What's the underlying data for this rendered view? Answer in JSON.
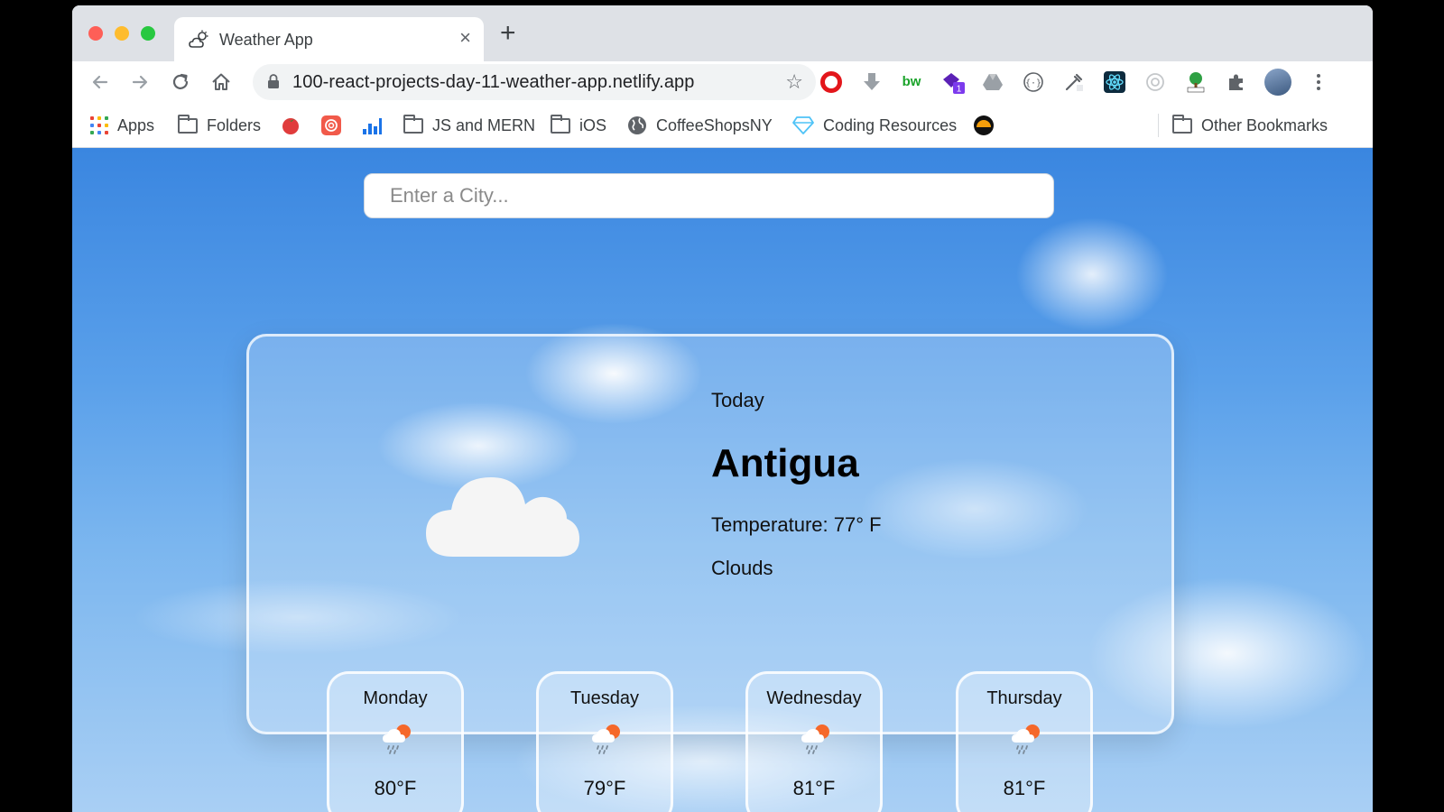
{
  "browser": {
    "tab_title": "Weather App",
    "tab_close": "×",
    "new_tab": "+",
    "url": "100-react-projects-day-11-weather-app.netlify.app",
    "bookmarks": [
      {
        "label": "Apps",
        "icon": "apps-grid-icon"
      },
      {
        "label": "Folders",
        "icon": "folder-icon"
      },
      {
        "label": "",
        "icon": "tomato-icon"
      },
      {
        "label": "",
        "icon": "spiral-icon"
      },
      {
        "label": "",
        "icon": "bar-chart-icon"
      },
      {
        "label": "JS and MERN",
        "icon": "folder-icon"
      },
      {
        "label": "iOS",
        "icon": "folder-icon"
      },
      {
        "label": "CoffeeShopsNY",
        "icon": "globe-icon"
      },
      {
        "label": "Coding Resources",
        "icon": "diamond-icon"
      },
      {
        "label": "",
        "icon": "circle-logo-icon"
      }
    ],
    "other_bookmarks": "Other Bookmarks",
    "extension_badge": "1"
  },
  "search": {
    "placeholder": "Enter a City..."
  },
  "current": {
    "day_label": "Today",
    "city": "Antigua",
    "temperature": "Temperature: 77° F",
    "description": "Clouds",
    "icon": "cloud-icon"
  },
  "forecast": [
    {
      "day": "Monday",
      "temp": "80°F",
      "icon": "sun-rain-cloud-icon"
    },
    {
      "day": "Tuesday",
      "temp": "79°F",
      "icon": "sun-rain-cloud-icon"
    },
    {
      "day": "Wednesday",
      "temp": "81°F",
      "icon": "sun-rain-cloud-icon"
    },
    {
      "day": "Thursday",
      "temp": "81°F",
      "icon": "sun-rain-cloud-icon"
    }
  ],
  "colors": {
    "sky_top": "#3a86e0",
    "sky_bottom": "#a9cff4",
    "sun": "#f5682a"
  }
}
